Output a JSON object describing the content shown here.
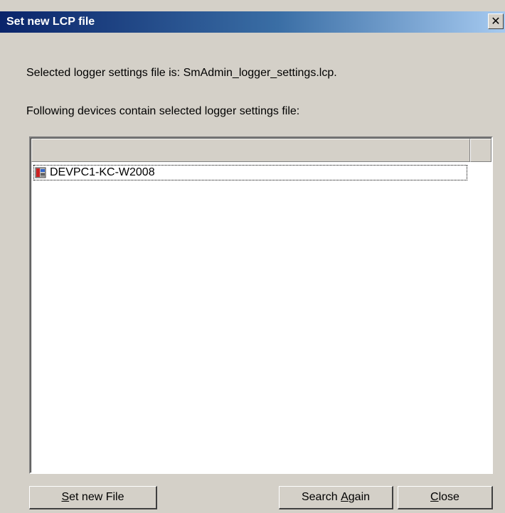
{
  "window": {
    "title": "Set new LCP file",
    "close_glyph": "✕"
  },
  "messages": {
    "selected": "Selected logger settings file is: SmAdmin_logger_settings.lcp.",
    "following": "Following devices contain selected logger settings file:"
  },
  "device_list": {
    "columns": [
      "",
      ""
    ],
    "items": [
      {
        "label": "DEVPC1-KC-W2008",
        "icon": "computer-device-icon"
      }
    ]
  },
  "buttons": {
    "set_new_file": {
      "mnemonic": "S",
      "rest": "et new File"
    },
    "search_again": {
      "pre": "Search ",
      "mnemonic": "A",
      "rest": "gain"
    },
    "close": {
      "mnemonic": "C",
      "rest": "lose"
    }
  }
}
